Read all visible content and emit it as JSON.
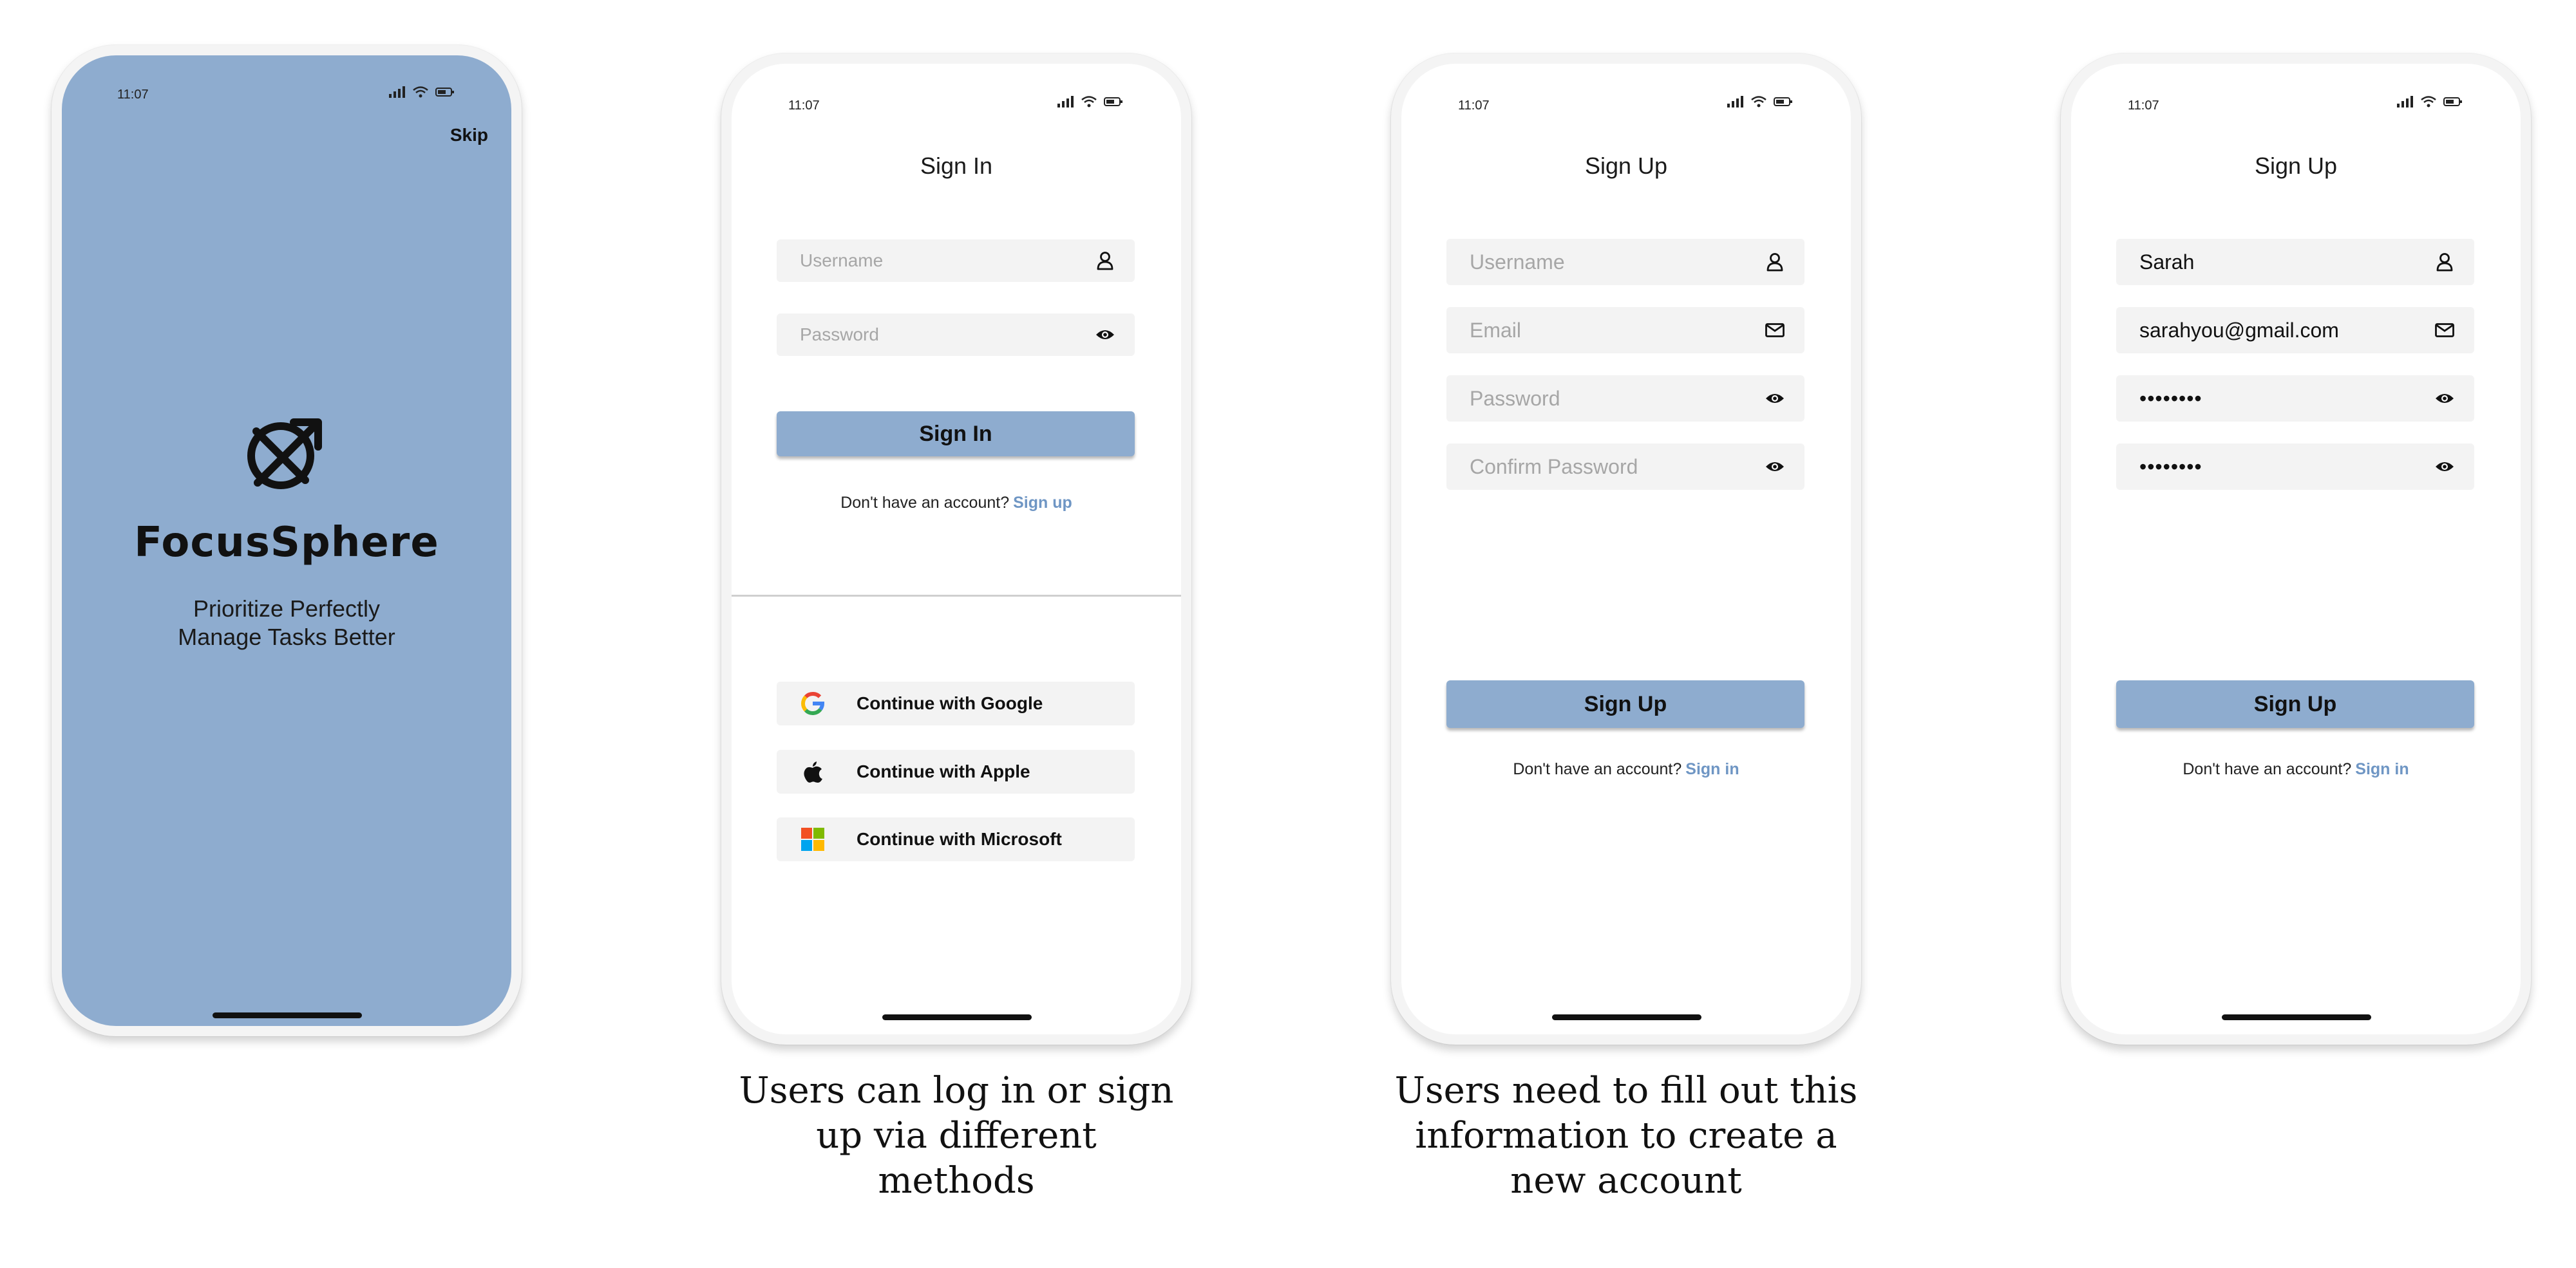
{
  "status_bar": {
    "time": "11:07"
  },
  "splash": {
    "skip_label": "Skip",
    "brand_name": "FocusSphere",
    "tagline_line1": "Prioritize Perfectly",
    "tagline_line2": "Manage Tasks Better",
    "background_color": "#8eaccf"
  },
  "sign_in": {
    "title": "Sign In",
    "username_placeholder": "Username",
    "password_placeholder": "Password",
    "button_label": "Sign In",
    "prompt_text": "Don't have an account?",
    "prompt_link": "Sign up",
    "social": [
      {
        "label": "Continue with Google",
        "icon": "google-icon"
      },
      {
        "label": "Continue with Apple",
        "icon": "apple-icon"
      },
      {
        "label": "Continue with Microsoft",
        "icon": "microsoft-icon"
      }
    ]
  },
  "sign_up": {
    "title": "Sign Up",
    "username_placeholder": "Username",
    "email_placeholder": "Email",
    "password_placeholder": "Password",
    "confirm_password_placeholder": "Confirm Password",
    "button_label": "Sign Up",
    "prompt_text": "Don't have an account?",
    "prompt_link": "Sign in"
  },
  "sign_up_filled": {
    "title": "Sign Up",
    "username_value": "Sarah",
    "email_value": "sarahyou@gmail.com",
    "password_value": "••••••••",
    "confirm_password_value": "••••••••",
    "button_label": "Sign Up",
    "prompt_text": "Don't have an account?",
    "prompt_link": "Sign in"
  },
  "captions": {
    "sign_in": "Users can log in or sign up via different methods",
    "sign_up": "Users need to fill out this information to create a new account"
  },
  "colors": {
    "accent": "#8eaccf",
    "link": "#6f96c4",
    "field_background": "#f3f3f3"
  }
}
